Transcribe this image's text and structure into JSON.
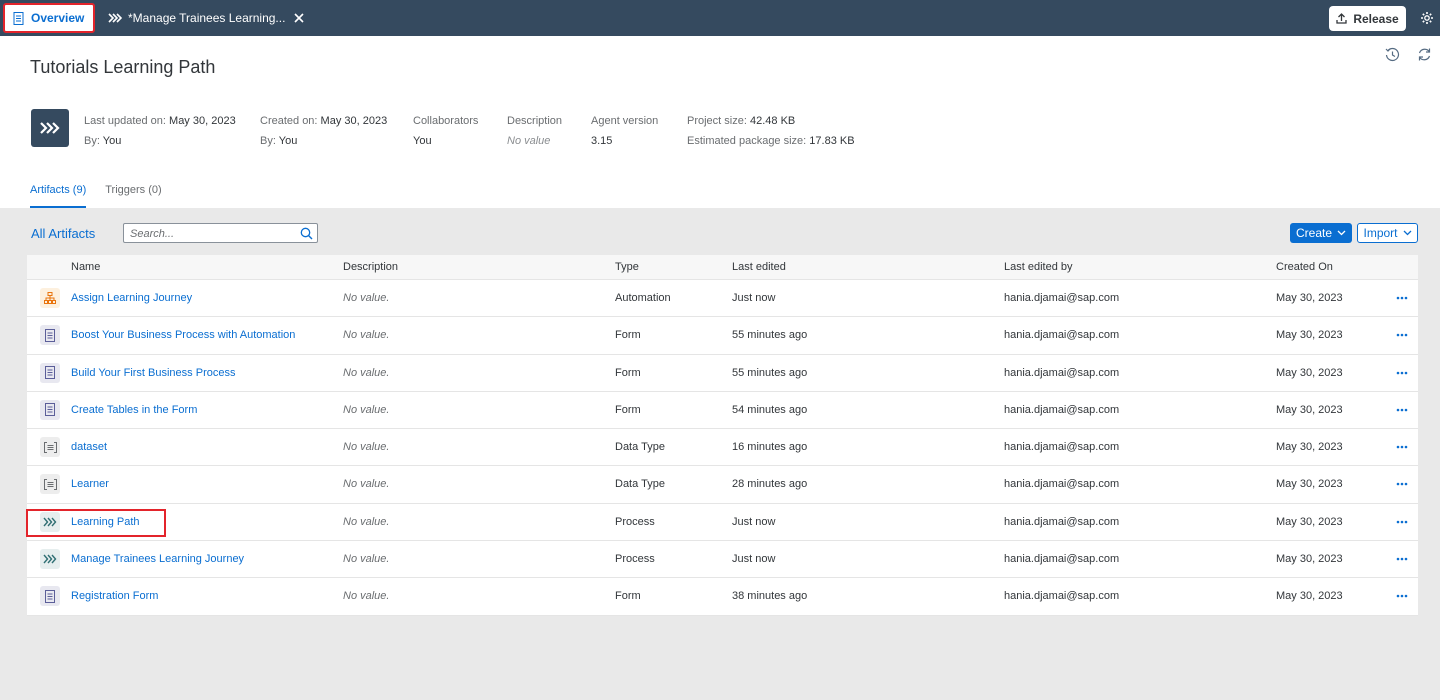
{
  "topbar": {
    "overview_tab": "Overview",
    "active_tab": "*Manage Trainees Learning...",
    "release_label": "Release"
  },
  "page": {
    "title": "Tutorials Learning Path"
  },
  "meta": {
    "last_updated_label": "Last updated on:",
    "last_updated_value": "May 30, 2023",
    "last_updated_by_label": "By:",
    "last_updated_by_value": "You",
    "created_label": "Created on:",
    "created_value": "May 30, 2023",
    "created_by_label": "By:",
    "created_by_value": "You",
    "collaborators_label": "Collaborators",
    "collaborators_value": "You",
    "description_label": "Description",
    "description_value": "No value",
    "agent_version_label": "Agent version",
    "agent_version_value": "3.15",
    "project_size_label": "Project size:",
    "project_size_value": "42.48 KB",
    "package_size_label": "Estimated package size:",
    "package_size_value": "17.83 KB"
  },
  "tabs": {
    "artifacts": "Artifacts (9)",
    "triggers": "Triggers (0)"
  },
  "toolbar": {
    "all_artifacts": "All Artifacts",
    "search_placeholder": "Search...",
    "create_label": "Create",
    "import_label": "Import"
  },
  "table": {
    "headers": {
      "name": "Name",
      "description": "Description",
      "type": "Type",
      "last_edited": "Last edited",
      "last_edited_by": "Last edited by",
      "created_on": "Created On"
    },
    "rows": [
      {
        "icon": "automation-icon",
        "name": "Assign Learning Journey",
        "description": "No value.",
        "type": "Automation",
        "last_edited": "Just now",
        "last_edited_by": "hania.djamai@sap.com",
        "created_on": "May 30, 2023"
      },
      {
        "icon": "form-icon",
        "name": "Boost Your Business Process with Automation",
        "description": "No value.",
        "type": "Form",
        "last_edited": "55 minutes ago",
        "last_edited_by": "hania.djamai@sap.com",
        "created_on": "May 30, 2023"
      },
      {
        "icon": "form-icon",
        "name": "Build Your First Business Process",
        "description": "No value.",
        "type": "Form",
        "last_edited": "55 minutes ago",
        "last_edited_by": "hania.djamai@sap.com",
        "created_on": "May 30, 2023"
      },
      {
        "icon": "form-icon",
        "name": "Create Tables in the Form",
        "description": "No value.",
        "type": "Form",
        "last_edited": "54 minutes ago",
        "last_edited_by": "hania.djamai@sap.com",
        "created_on": "May 30, 2023"
      },
      {
        "icon": "data-type-icon",
        "name": "dataset",
        "description": "No value.",
        "type": "Data Type",
        "last_edited": "16 minutes ago",
        "last_edited_by": "hania.djamai@sap.com",
        "created_on": "May 30, 2023"
      },
      {
        "icon": "data-type-icon",
        "name": "Learner",
        "description": "No value.",
        "type": "Data Type",
        "last_edited": "28 minutes ago",
        "last_edited_by": "hania.djamai@sap.com",
        "created_on": "May 30, 2023"
      },
      {
        "icon": "process-icon",
        "name": "Learning Path",
        "description": "No value.",
        "type": "Process",
        "last_edited": "Just now",
        "last_edited_by": "hania.djamai@sap.com",
        "created_on": "May 30, 2023"
      },
      {
        "icon": "process-icon",
        "name": "Manage Trainees Learning Journey",
        "description": "No value.",
        "type": "Process",
        "last_edited": "Just now",
        "last_edited_by": "hania.djamai@sap.com",
        "created_on": "May 30, 2023"
      },
      {
        "icon": "form-icon",
        "name": "Registration Form",
        "description": "No value.",
        "type": "Form",
        "last_edited": "38 minutes ago",
        "last_edited_by": "hania.djamai@sap.com",
        "created_on": "May 30, 2023"
      }
    ]
  },
  "colors": {
    "shell": "#354a5f",
    "accent": "#0a6ed1",
    "highlight": "#e3242b"
  }
}
